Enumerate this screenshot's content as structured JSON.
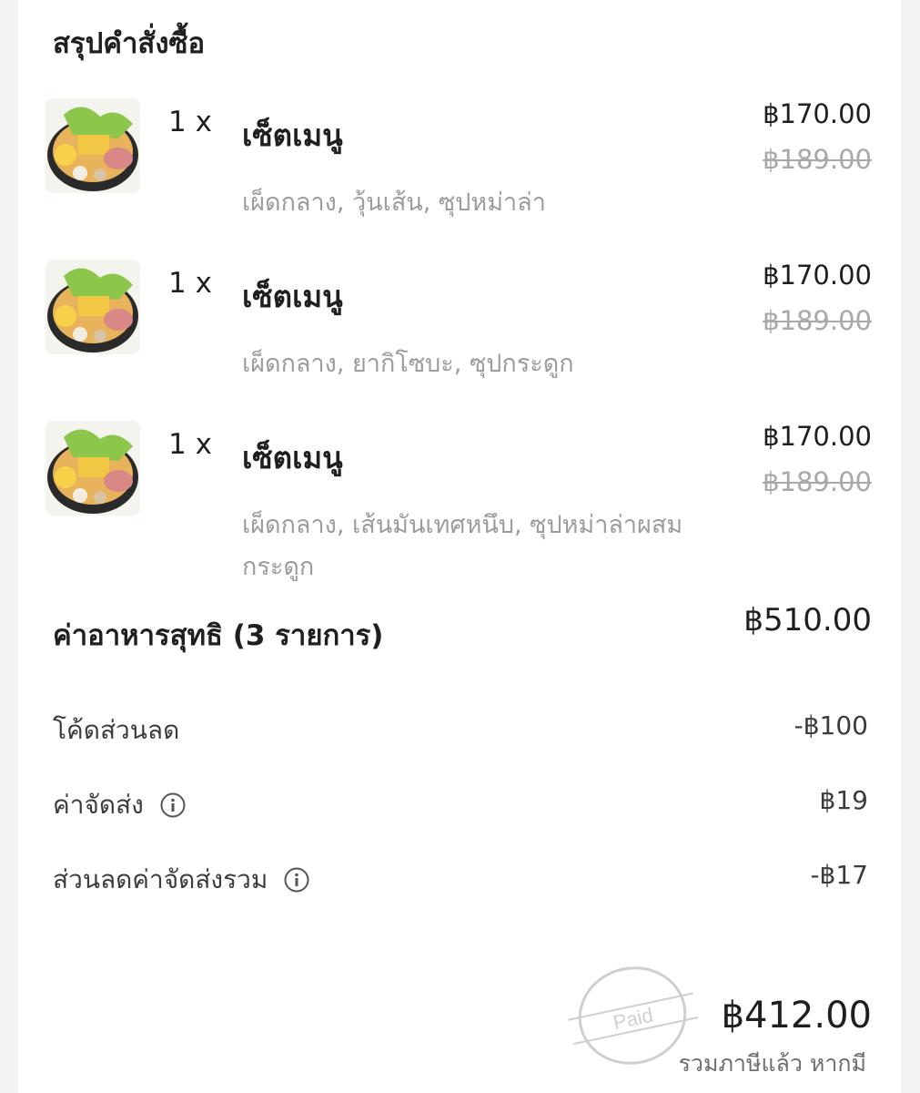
{
  "summary": {
    "title": "สรุปคำสั่งซื้อ"
  },
  "items": [
    {
      "qty": "1 x",
      "name": "เซ็ตเมนู",
      "price": "฿170.00",
      "original_price": "฿189.00",
      "options": "เผ็ดกลาง, วุ้นเส้น, ซุปหม่าล่า"
    },
    {
      "qty": "1 x",
      "name": "เซ็ตเมนู",
      "price": "฿170.00",
      "original_price": "฿189.00",
      "options": "เผ็ดกลาง, ยากิโซบะ, ซุปกระดูก"
    },
    {
      "qty": "1 x",
      "name": "เซ็ตเมนู",
      "price": "฿170.00",
      "original_price": "฿189.00",
      "options": "เผ็ดกลาง, เส้นมันเทศหนึบ, ซุปหม่าล่าผสมกระดูก"
    }
  ],
  "subtotal": {
    "label": "ค่าอาหารสุทธิ (3 รายการ)",
    "value": "฿510.00"
  },
  "fees": {
    "discount_code_label": "โค้ดส่วนลด",
    "discount_code_value": "-฿100",
    "delivery_label": "ค่าจัดส่ง",
    "delivery_value": "฿19",
    "delivery_discount_label": "ส่วนลดค่าจัดส่งรวม",
    "delivery_discount_value": "-฿17"
  },
  "total": {
    "value": "฿412.00",
    "note": "รวมภาษีแล้ว หากมี",
    "stamp_text": "Paid"
  },
  "icons": {
    "info": "info-circle-icon",
    "food": "hotpot-set-image"
  },
  "colors": {
    "text": "#1f1f1f",
    "muted": "#9c9c9c",
    "background": "#f2f2f2",
    "card": "#ffffff"
  }
}
